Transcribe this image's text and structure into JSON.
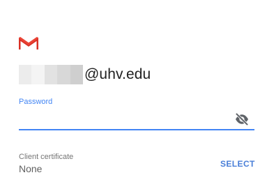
{
  "logo": {
    "icon": "gmail-icon",
    "color": "#d93025"
  },
  "account": {
    "domain": "@uhv.edu"
  },
  "password": {
    "label": "Password",
    "value": "",
    "toggle_icon": "visibility-off-icon",
    "accent": "#4285f4"
  },
  "certificate": {
    "label": "Client certificate",
    "value": "None",
    "action_label": "SELECT"
  }
}
